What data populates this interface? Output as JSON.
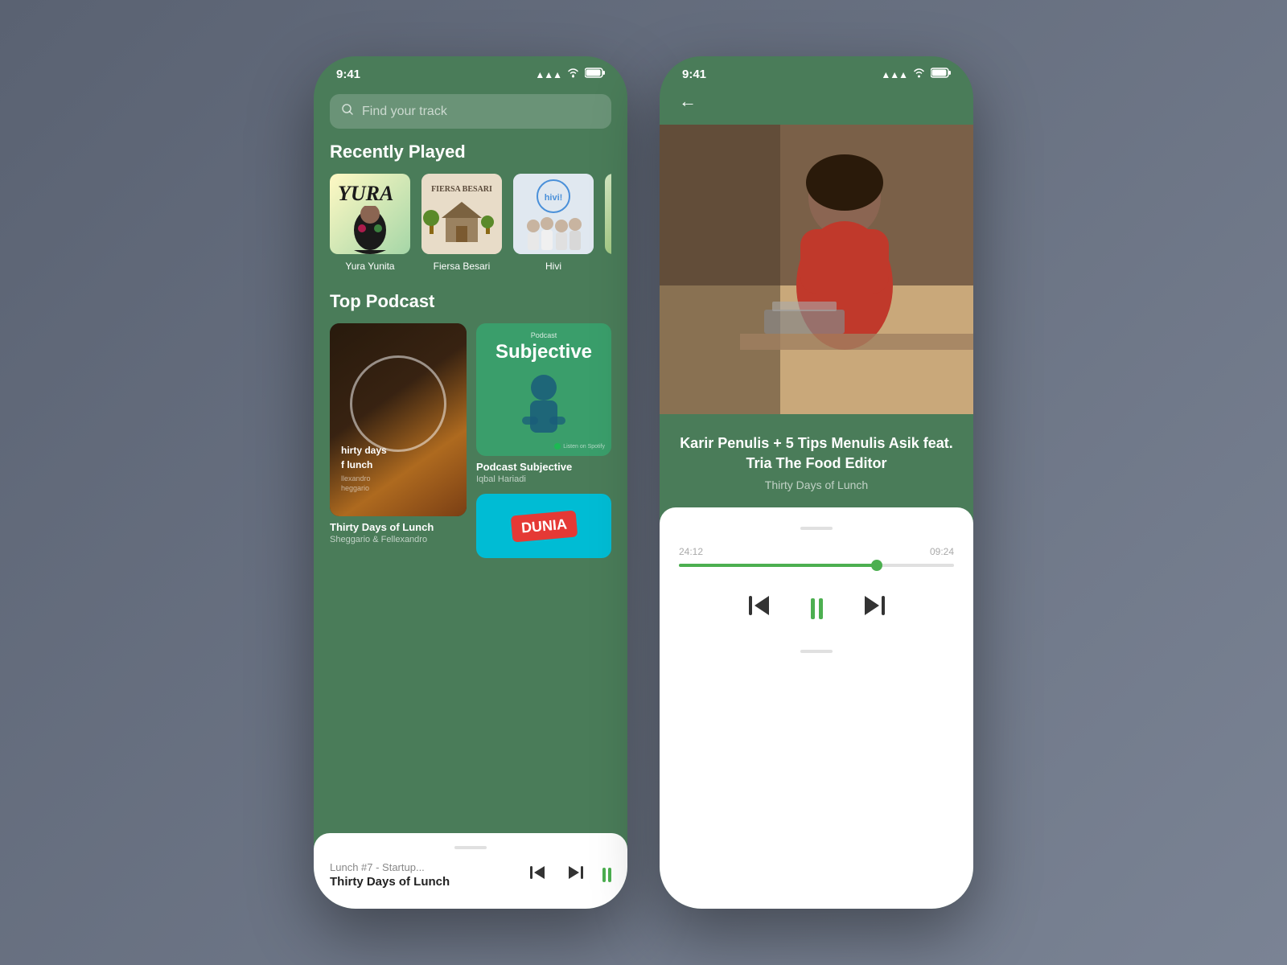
{
  "phone1": {
    "status": {
      "time": "9:41",
      "signal": "▲▲▲",
      "wifi": "wifi",
      "battery": "▬"
    },
    "search": {
      "placeholder": "Find your track"
    },
    "recently_played": {
      "title": "Recently Played",
      "albums": [
        {
          "id": "yura",
          "name": "Yura Yunita"
        },
        {
          "id": "fiersa",
          "name": "Fiersa Besari"
        },
        {
          "id": "hivi",
          "name": "Hivi"
        }
      ]
    },
    "top_podcast": {
      "title": "Top Podcast",
      "podcasts": [
        {
          "id": "thirty",
          "name": "Thirty Days of Lunch",
          "author": "Sheggario & Fellexandro"
        },
        {
          "id": "subjective",
          "name": "Podcast Subjective",
          "author": "Iqbal Hariadi",
          "label_small": "Podcast",
          "label_large": "Subjective",
          "listen_text": "Listen on Spotify"
        }
      ]
    },
    "mini_player": {
      "track": "Lunch #7 - Startup...",
      "artist": "Thirty Days of Lunch",
      "prev_label": "⏮",
      "next_label": "⏭"
    }
  },
  "phone2": {
    "status": {
      "time": "9:41"
    },
    "back_label": "←",
    "track_title": "Karir Penulis + 5 Tips Menulis Asik feat. Tria The Food Editor",
    "track_subtitle": "Thirty Days of Lunch",
    "player": {
      "time_elapsed": "24:12",
      "time_remaining": "09:24",
      "progress_percent": 72,
      "prev_label": "⏮",
      "next_label": "⏭"
    }
  }
}
